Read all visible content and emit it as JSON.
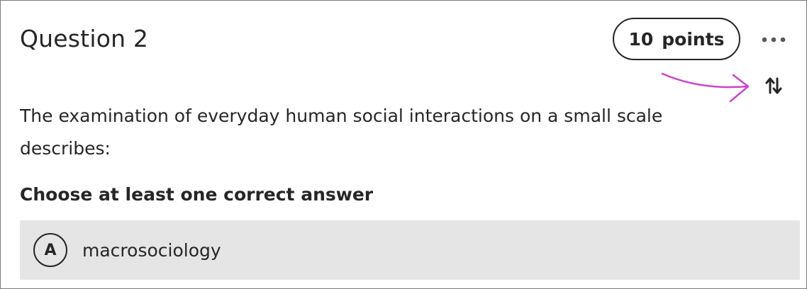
{
  "question": {
    "title": "Question 2",
    "points_value": "10",
    "points_label": "points",
    "more_icon": "more-horizontal-icon",
    "reorder_icon": "reorder-arrows-icon",
    "prompt": "The examination of everyday human social interactions on a small scale describes:",
    "instruction": "Choose at least one correct answer",
    "options": [
      {
        "letter": "A",
        "text": "macrosociology"
      }
    ]
  },
  "annotation": {
    "color": "#cc44cc"
  },
  "colors": {
    "text": "#262626",
    "option_bg": "#e5e5e5",
    "border": "#7a7a7a"
  }
}
